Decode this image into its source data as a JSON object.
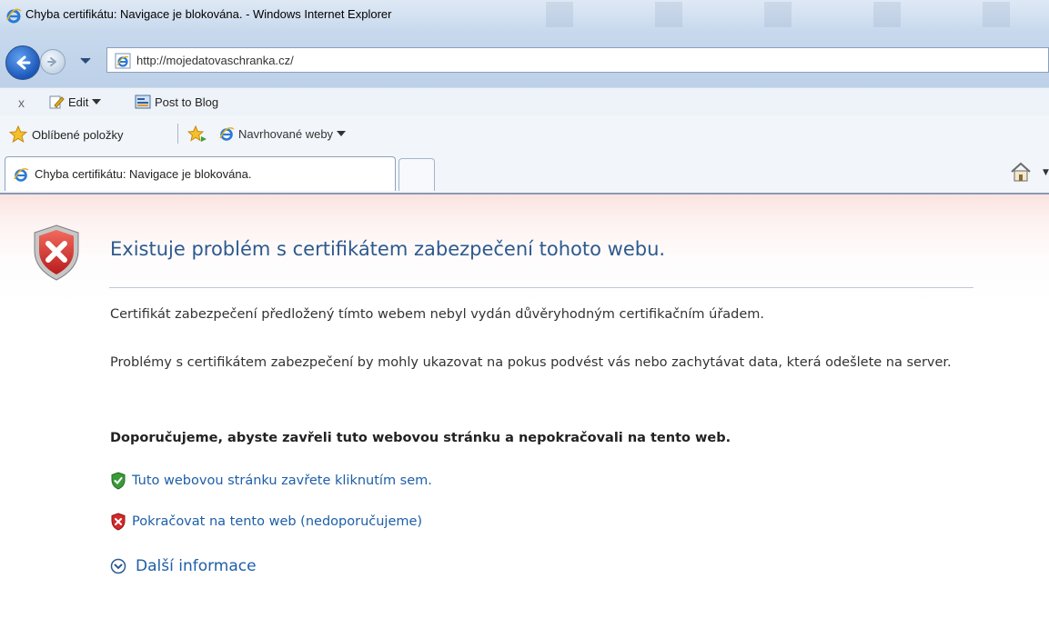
{
  "window": {
    "title": "Chyba certifikátu: Navigace je blokována. - Windows Internet Explorer"
  },
  "address_bar": {
    "url": "http://mojedatovaschranka.cz/"
  },
  "command_bar": {
    "stop_label": "x",
    "edit_label": "Edit",
    "post_to_blog_label": "Post to Blog"
  },
  "favorites_bar": {
    "favorites_label": "Oblíbené položky",
    "suggested_sites_label": "Navrhované weby"
  },
  "tabs": [
    {
      "label": "Chyba certifikátu: Navigace je blokována.",
      "active": true
    }
  ],
  "page": {
    "heading": "Existuje problém s certifikátem zabezpečení tohoto webu.",
    "paragraph1": "Certifikát zabezpečení předložený tímto webem nebyl vydán důvěryhodným certifikačním úřadem.",
    "paragraph2": "Problémy s certifikátem zabezpečení by mohly ukazovat na pokus podvést vás nebo zachytávat data, která odešlete na server.",
    "recommendation": "Doporučujeme, abyste zavřeli tuto webovou stránku a nepokračovali na tento web.",
    "close_link": "Tuto webovou stránku zavřete kliknutím sem.",
    "continue_link": "Pokračovat na tento web (nedoporučujeme)",
    "more_info": "Další informace"
  },
  "colors": {
    "heading": "#2d5a8e",
    "link": "#1d5ea8",
    "error_red": "#d3292b",
    "safe_green": "#3a9a3a"
  }
}
